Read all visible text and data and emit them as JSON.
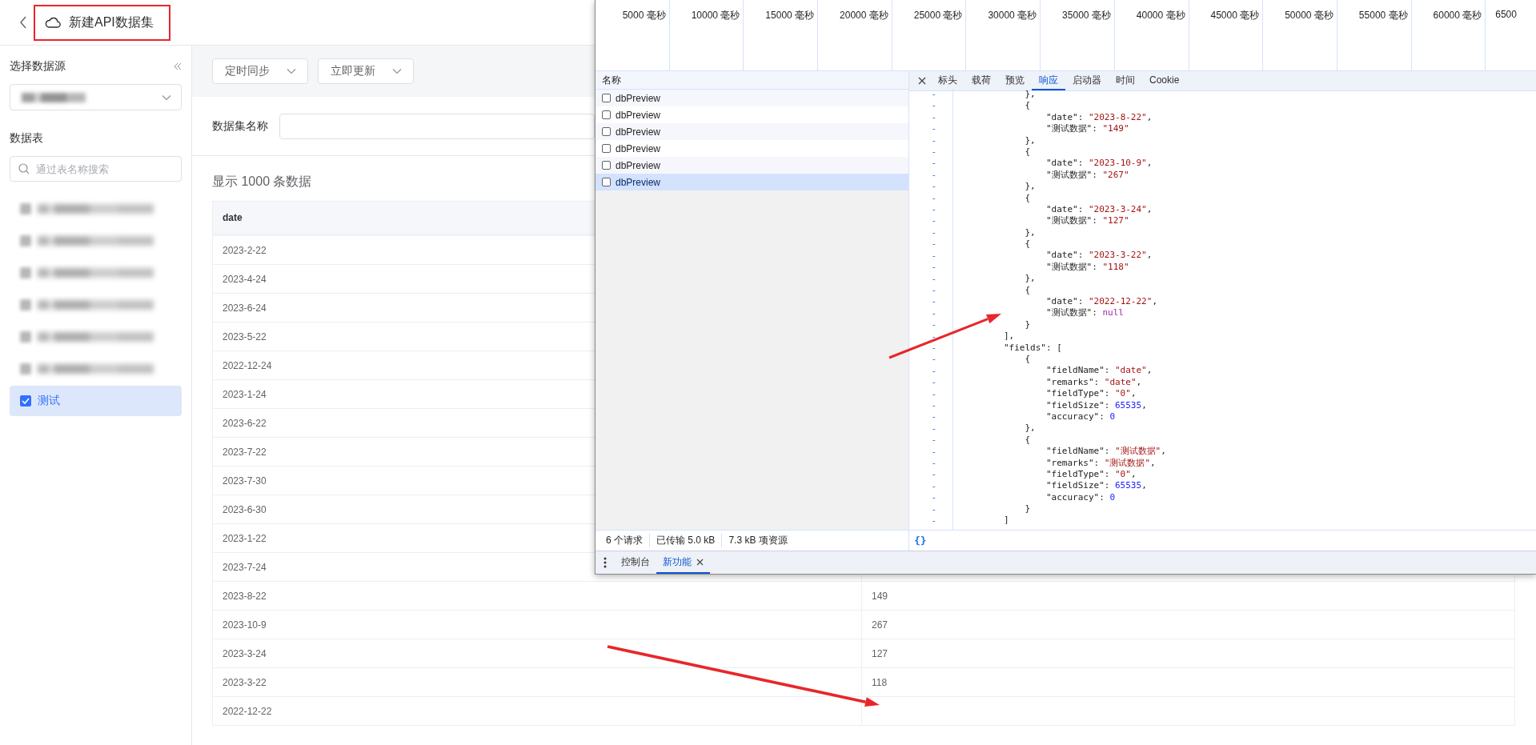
{
  "header": {
    "title": "新建API数据集"
  },
  "sidebar": {
    "source_label": "选择数据源",
    "source_blurred": true,
    "tables_label": "数据表",
    "search": {
      "placeholder": "通过表名称搜索"
    },
    "tables": [
      {
        "blurred": true,
        "checked": false,
        "selected": false
      },
      {
        "blurred": true,
        "checked": false,
        "selected": false
      },
      {
        "blurred": true,
        "checked": false,
        "selected": false
      },
      {
        "blurred": true,
        "checked": false,
        "selected": false
      },
      {
        "blurred": true,
        "checked": false,
        "selected": false
      },
      {
        "blurred": true,
        "checked": false,
        "selected": false
      },
      {
        "label": "测试",
        "blurred": false,
        "checked": true,
        "selected": true
      }
    ]
  },
  "toolbar": {
    "buttons": [
      {
        "label": "定时同步"
      },
      {
        "label": "立即更新"
      }
    ]
  },
  "name_field": {
    "label": "数据集名称"
  },
  "preview": {
    "heading": "显示 1000 条数据",
    "columns": [
      {
        "label": "date"
      }
    ],
    "rows": [
      {
        "cells": [
          "2023-2-22"
        ]
      },
      {
        "cells": [
          "2023-4-24"
        ]
      },
      {
        "cells": [
          "2023-6-24"
        ]
      },
      {
        "cells": [
          "2023-5-22"
        ]
      },
      {
        "cells": [
          "2022-12-24"
        ]
      },
      {
        "cells": [
          "2023-1-24"
        ]
      },
      {
        "cells": [
          "2023-6-22"
        ]
      },
      {
        "cells": [
          "2023-7-22"
        ]
      },
      {
        "cells": [
          "2023-7-30"
        ]
      },
      {
        "cells": [
          "2023-6-30"
        ]
      },
      {
        "cells": [
          "2023-1-22"
        ]
      },
      {
        "cells": [
          "2023-7-24"
        ]
      },
      {
        "cells": [
          "2023-8-22",
          "149"
        ]
      },
      {
        "cells": [
          "2023-10-9",
          "267"
        ]
      },
      {
        "cells": [
          "2023-3-24",
          "127"
        ]
      },
      {
        "cells": [
          "2023-3-22",
          "118"
        ]
      },
      {
        "cells": [
          "2022-12-22"
        ]
      }
    ]
  },
  "devtools": {
    "timeline": {
      "ticks": [
        "5000 毫秒",
        "10000 毫秒",
        "15000 毫秒",
        "20000 毫秒",
        "25000 毫秒",
        "30000 毫秒",
        "35000 毫秒",
        "40000 毫秒",
        "45000 毫秒",
        "50000 毫秒",
        "55000 毫秒",
        "60000 毫秒",
        "6500"
      ]
    },
    "requests": {
      "column": "名称",
      "rows": [
        {
          "name": "dbPreview",
          "selected": false
        },
        {
          "name": "dbPreview",
          "selected": false
        },
        {
          "name": "dbPreview",
          "selected": false
        },
        {
          "name": "dbPreview",
          "selected": false
        },
        {
          "name": "dbPreview",
          "selected": false
        },
        {
          "name": "dbPreview",
          "selected": true
        }
      ]
    },
    "status": [
      "6 个请求",
      "已传输 5.0 kB",
      "7.3 kB 项资源"
    ],
    "tabs": [
      {
        "label": "标头",
        "selected": false
      },
      {
        "label": "载荷",
        "selected": false
      },
      {
        "label": "预览",
        "selected": false
      },
      {
        "label": "响应",
        "selected": true
      },
      {
        "label": "启动器",
        "selected": false
      },
      {
        "label": "时间",
        "selected": false
      },
      {
        "label": "Cookie",
        "selected": false
      }
    ],
    "code": [
      {
        "marker": "-",
        "tokens": [
          {
            "kind": "plain",
            "text": "            },"
          }
        ]
      },
      {
        "marker": "-",
        "tokens": [
          {
            "kind": "plain",
            "text": "            {"
          }
        ]
      },
      {
        "marker": "-",
        "tokens": [
          {
            "kind": "plain",
            "text": "                \"date\": "
          },
          {
            "kind": "string",
            "text": "\"2023-8-22\""
          },
          {
            "kind": "plain",
            "text": ","
          }
        ]
      },
      {
        "marker": "-",
        "tokens": [
          {
            "kind": "plain",
            "text": "                \"测试数据\": "
          },
          {
            "kind": "string",
            "text": "\"149\""
          }
        ]
      },
      {
        "marker": "-",
        "tokens": [
          {
            "kind": "plain",
            "text": "            },"
          }
        ]
      },
      {
        "marker": "-",
        "tokens": [
          {
            "kind": "plain",
            "text": "            {"
          }
        ]
      },
      {
        "marker": "-",
        "tokens": [
          {
            "kind": "plain",
            "text": "                \"date\": "
          },
          {
            "kind": "string",
            "text": "\"2023-10-9\""
          },
          {
            "kind": "plain",
            "text": ","
          }
        ]
      },
      {
        "marker": "-",
        "tokens": [
          {
            "kind": "plain",
            "text": "                \"测试数据\": "
          },
          {
            "kind": "string",
            "text": "\"267\""
          }
        ]
      },
      {
        "marker": "-",
        "tokens": [
          {
            "kind": "plain",
            "text": "            },"
          }
        ]
      },
      {
        "marker": "-",
        "tokens": [
          {
            "kind": "plain",
            "text": "            {"
          }
        ]
      },
      {
        "marker": "-",
        "tokens": [
          {
            "kind": "plain",
            "text": "                \"date\": "
          },
          {
            "kind": "string",
            "text": "\"2023-3-24\""
          },
          {
            "kind": "plain",
            "text": ","
          }
        ]
      },
      {
        "marker": "-",
        "tokens": [
          {
            "kind": "plain",
            "text": "                \"测试数据\": "
          },
          {
            "kind": "string",
            "text": "\"127\""
          }
        ]
      },
      {
        "marker": "-",
        "tokens": [
          {
            "kind": "plain",
            "text": "            },"
          }
        ]
      },
      {
        "marker": "-",
        "tokens": [
          {
            "kind": "plain",
            "text": "            {"
          }
        ]
      },
      {
        "marker": "-",
        "tokens": [
          {
            "kind": "plain",
            "text": "                \"date\": "
          },
          {
            "kind": "string",
            "text": "\"2023-3-22\""
          },
          {
            "kind": "plain",
            "text": ","
          }
        ]
      },
      {
        "marker": "-",
        "tokens": [
          {
            "kind": "plain",
            "text": "                \"测试数据\": "
          },
          {
            "kind": "string",
            "text": "\"118\""
          }
        ]
      },
      {
        "marker": "-",
        "tokens": [
          {
            "kind": "plain",
            "text": "            },"
          }
        ]
      },
      {
        "marker": "-",
        "tokens": [
          {
            "kind": "plain",
            "text": "            {"
          }
        ]
      },
      {
        "marker": "-",
        "tokens": [
          {
            "kind": "plain",
            "text": "                \"date\": "
          },
          {
            "kind": "string",
            "text": "\"2022-12-22\""
          },
          {
            "kind": "plain",
            "text": ","
          }
        ]
      },
      {
        "marker": "-",
        "tokens": [
          {
            "kind": "plain",
            "text": "                \"测试数据\": "
          },
          {
            "kind": "null",
            "text": "null"
          }
        ]
      },
      {
        "marker": "-",
        "tokens": [
          {
            "kind": "plain",
            "text": "            }"
          }
        ]
      },
      {
        "marker": "-",
        "tokens": [
          {
            "kind": "plain",
            "text": "        ],"
          }
        ]
      },
      {
        "marker": "-",
        "tokens": [
          {
            "kind": "plain",
            "text": "        \"fields\": ["
          }
        ]
      },
      {
        "marker": "-",
        "tokens": [
          {
            "kind": "plain",
            "text": "            {"
          }
        ]
      },
      {
        "marker": "-",
        "tokens": [
          {
            "kind": "plain",
            "text": "                \"fieldName\": "
          },
          {
            "kind": "string",
            "text": "\"date\""
          },
          {
            "kind": "plain",
            "text": ","
          }
        ]
      },
      {
        "marker": "-",
        "tokens": [
          {
            "kind": "plain",
            "text": "                \"remarks\": "
          },
          {
            "kind": "string",
            "text": "\"date\""
          },
          {
            "kind": "plain",
            "text": ","
          }
        ]
      },
      {
        "marker": "-",
        "tokens": [
          {
            "kind": "plain",
            "text": "                \"fieldType\": "
          },
          {
            "kind": "string",
            "text": "\"0\""
          },
          {
            "kind": "plain",
            "text": ","
          }
        ]
      },
      {
        "marker": "-",
        "tokens": [
          {
            "kind": "plain",
            "text": "                \"fieldSize\": "
          },
          {
            "kind": "number",
            "text": "65535"
          },
          {
            "kind": "plain",
            "text": ","
          }
        ]
      },
      {
        "marker": "-",
        "tokens": [
          {
            "kind": "plain",
            "text": "                \"accuracy\": "
          },
          {
            "kind": "number",
            "text": "0"
          }
        ]
      },
      {
        "marker": "-",
        "tokens": [
          {
            "kind": "plain",
            "text": "            },"
          }
        ]
      },
      {
        "marker": "-",
        "tokens": [
          {
            "kind": "plain",
            "text": "            {"
          }
        ]
      },
      {
        "marker": "-",
        "tokens": [
          {
            "kind": "plain",
            "text": "                \"fieldName\": "
          },
          {
            "kind": "string",
            "text": "\"测试数据\""
          },
          {
            "kind": "plain",
            "text": ","
          }
        ]
      },
      {
        "marker": "-",
        "tokens": [
          {
            "kind": "plain",
            "text": "                \"remarks\": "
          },
          {
            "kind": "string",
            "text": "\"测试数据\""
          },
          {
            "kind": "plain",
            "text": ","
          }
        ]
      },
      {
        "marker": "-",
        "tokens": [
          {
            "kind": "plain",
            "text": "                \"fieldType\": "
          },
          {
            "kind": "string",
            "text": "\"0\""
          },
          {
            "kind": "plain",
            "text": ","
          }
        ]
      },
      {
        "marker": "-",
        "tokens": [
          {
            "kind": "plain",
            "text": "                \"fieldSize\": "
          },
          {
            "kind": "number",
            "text": "65535"
          },
          {
            "kind": "plain",
            "text": ","
          }
        ]
      },
      {
        "marker": "-",
        "tokens": [
          {
            "kind": "plain",
            "text": "                \"accuracy\": "
          },
          {
            "kind": "number",
            "text": "0"
          }
        ]
      },
      {
        "marker": "-",
        "tokens": [
          {
            "kind": "plain",
            "text": "            }"
          }
        ]
      },
      {
        "marker": "-",
        "tokens": [
          {
            "kind": "plain",
            "text": "        ]"
          }
        ]
      }
    ],
    "format_button": "{}",
    "drawer_tabs": [
      {
        "label": "控制台",
        "selected": false,
        "closable": false
      },
      {
        "label": "新功能",
        "selected": true,
        "closable": true
      }
    ]
  }
}
